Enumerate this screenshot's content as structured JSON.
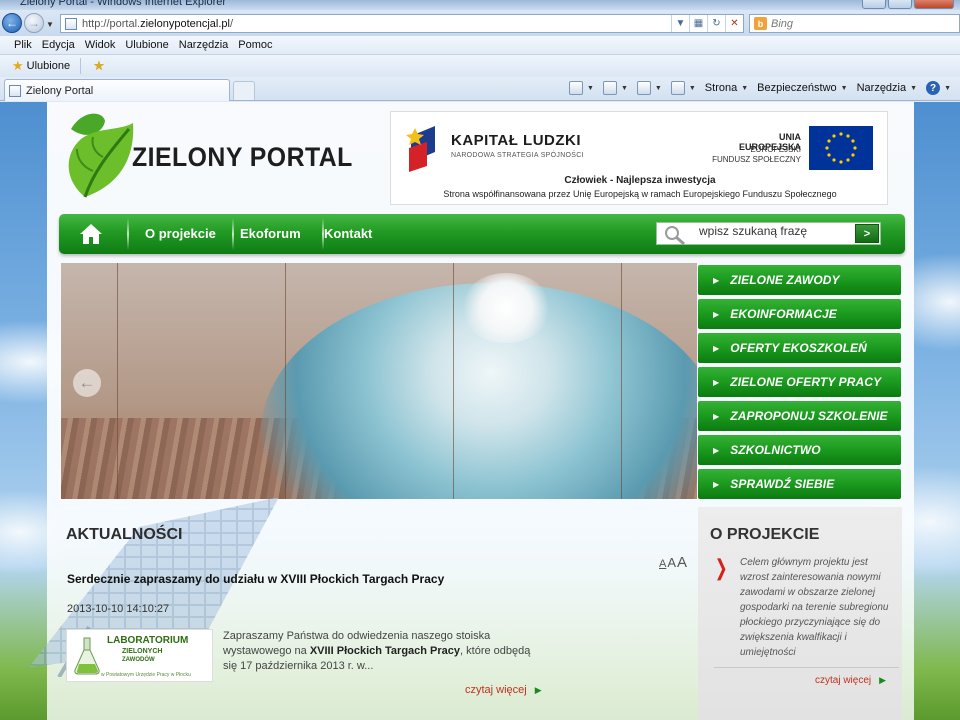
{
  "browser": {
    "title": "Zielony Portal - Windows Internet Explorer",
    "url_prefix": "http://portal.",
    "url_domain": "zielonypotencjal.pl",
    "url_suffix": "/",
    "search_placeholder": "Bing",
    "menu": [
      "Plik",
      "Edycja",
      "Widok",
      "Ulubione",
      "Narzędzia",
      "Pomoc"
    ],
    "favorites_label": "Ulubione",
    "tab_title": "Zielony Portal",
    "commands": {
      "strona": "Strona",
      "bezpieczenstwo": "Bezpieczeństwo",
      "narzedzia": "Narzędzia"
    }
  },
  "header": {
    "logo_text": "ZIELONY PORTAL",
    "kl_title": "KAPITAŁ LUDZKI",
    "kl_subtitle": "NARODOWA STRATEGIA SPÓJNOŚCI",
    "eu_line1": "UNIA EUROPEJSKA",
    "eu_line2": "EUROPEJSKI",
    "eu_line3": "FUNDUSZ SPOŁECZNY",
    "slogan": "Człowiek - Najlepsza inwestycja",
    "slogan2": "Strona współfinansowana przez Unię Europejską w ramach Europejskiego Funduszu Społecznego"
  },
  "nav": {
    "links": [
      "O projekcie",
      "Ekoforum",
      "Kontakt"
    ],
    "search_placeholder": "wpisz szukaną frazę",
    "search_button": ">"
  },
  "side_menu": [
    "ZIELONE ZAWODY",
    "EKOINFORMACJE",
    "OFERTY EKOSZKOLEŃ",
    "ZIELONE OFERTY PRACY",
    "ZAPROPONUJ SZKOLENIE",
    "SZKOLNICTWO",
    "SPRAWDŹ SIEBIE"
  ],
  "news": {
    "heading": "AKTUALNOŚCI",
    "font_sizes": [
      "A",
      "A",
      "A"
    ],
    "article": {
      "title": "Serdecznie zapraszamy do udziału w XVIII Płockich Targach Pracy",
      "date": "2013-10-10 14:10:27",
      "body_1": "Zapraszamy Państwa do odwiedzenia naszego stoiska wystawowego na ",
      "body_bold": "XVIII Płockich Targach Pracy",
      "body_2": ", które odbędą się 17 października 2013 r. w...",
      "more": "czytaj więcej",
      "logo_line1": "LABORATORIUM",
      "logo_line2": "ZIELONYCH",
      "logo_line3": "ZAWODÓW",
      "logo_line4": "w Powiatowym Urzędzie Pracy w Płocku"
    }
  },
  "project": {
    "heading": "O PROJEKCIE",
    "text": "Celem głównym projektu jest wzrost zainteresowania nowymi zawodami w obszarze zielonej gospodarki na terenie subregionu płockiego przyczyniające się do zwiększenia kwalfikacji i umiejętności",
    "more": "czytaj więcej"
  }
}
